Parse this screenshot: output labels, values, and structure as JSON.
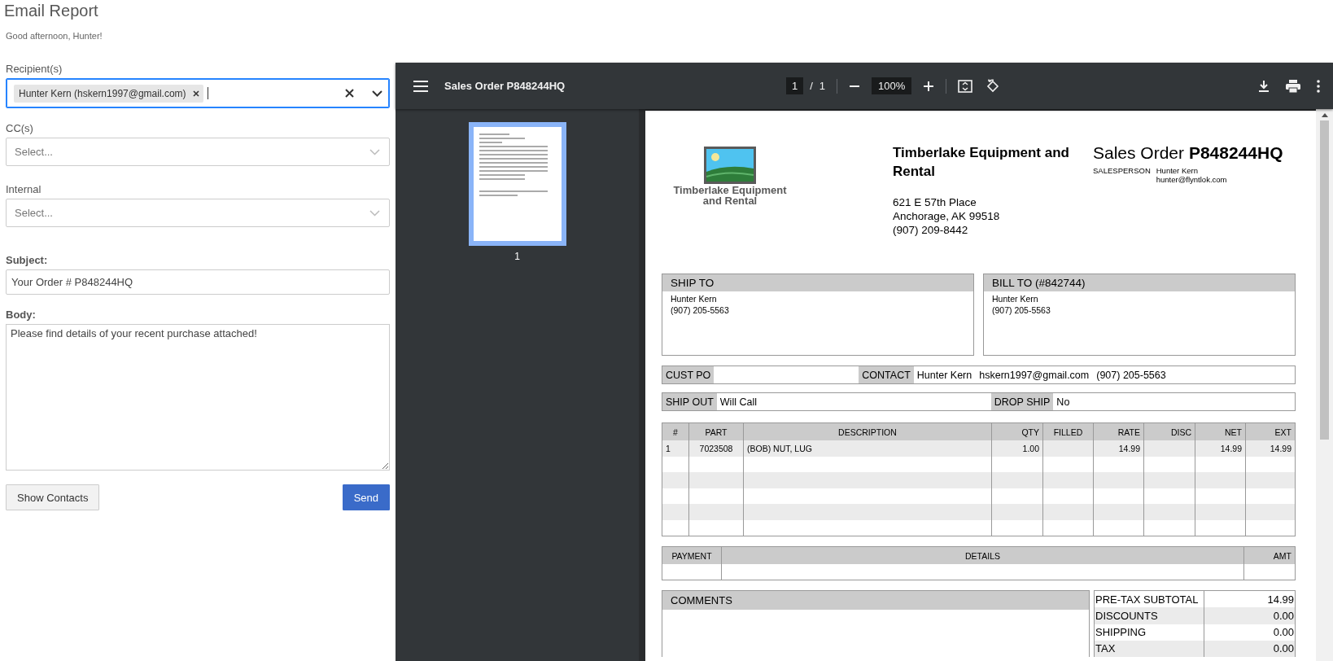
{
  "header": {
    "title": "Email Report",
    "greeting": "Good afternoon, Hunter!"
  },
  "form": {
    "recipients": {
      "label": "Recipient(s)",
      "focused": true,
      "chips": [
        {
          "label": "Hunter Kern (hskern1997@gmail.com)"
        }
      ]
    },
    "cc": {
      "label": "CC(s)",
      "placeholder": "Select..."
    },
    "internal": {
      "label": "Internal",
      "placeholder": "Select..."
    },
    "subject": {
      "label": "Subject:",
      "value": "Your Order # P848244HQ"
    },
    "body": {
      "label": "Body:",
      "value": "Please find details of your recent purchase attached!"
    },
    "buttons": [
      {
        "kind": "secondary",
        "label": "Show Contacts"
      },
      {
        "kind": "primary",
        "label": "Send"
      }
    ]
  },
  "viewer": {
    "toolbar": {
      "title": "Sales Order P848244HQ",
      "page_current": "1",
      "page_separator": "/",
      "page_total": "1",
      "zoom": "100%"
    },
    "thumbnails": [
      {
        "page_label": "1",
        "selected": true
      }
    ],
    "document": {
      "logo_text": [
        "Timberlake Equipment",
        "and Rental"
      ],
      "company_name": "Timberlake Equipment and Rental",
      "address": [
        "621 E 57th Place",
        "Anchorage, AK 99518",
        "(907) 209-8442"
      ],
      "order_title": "Sales Order **P848244HQ**",
      "salesperson": {
        "label": "SALESPERSON",
        "name": "Hunter Kern",
        "email": "hunter@flyntlok.com"
      },
      "ship_to": {
        "heading": "SHIP TO",
        "lines": [
          "Hunter Kern",
          "(907) 205-5563"
        ]
      },
      "bill_to": {
        "heading": "BILL TO (#842744)",
        "lines": [
          "Hunter Kern",
          "(907) 205-5563"
        ]
      },
      "info_rows": [
        [
          {
            "label": "CUST PO"
          },
          {
            "label": "CONTACT",
            "values": [
              "Hunter Kern",
              "hskern1997@gmail.com",
              "(907) 205-5563"
            ]
          }
        ],
        [
          {
            "label": "SHIP OUT",
            "values": [
              "Will Call"
            ]
          },
          {
            "label": "DROP SHIP",
            "values": [
              "No"
            ]
          }
        ]
      ],
      "items": {
        "columns": [
          "#",
          "PART",
          "DESCRIPTION",
          "QTY",
          "FILLED",
          "RATE",
          "DISC",
          "NET",
          "EXT"
        ],
        "rows": [
          [
            "1",
            "7023508",
            "(BOB) NUT, LUG",
            "1.00",
            null,
            "14.99",
            null,
            "14.99",
            "14.99"
          ]
        ]
      },
      "payments": {
        "columns": [
          "PAYMENT",
          "DETAILS",
          "AMT"
        ]
      },
      "comments": {
        "heading": "COMMENTS"
      },
      "totals": [
        {
          "label": "PRE-TAX SUBTOTAL",
          "value": "14.99"
        },
        {
          "label": "DISCOUNTS",
          "value": "0.00"
        },
        {
          "label": "SHIPPING",
          "value": "0.00"
        },
        {
          "label": "TAX",
          "value": "0.00"
        }
      ]
    }
  }
}
